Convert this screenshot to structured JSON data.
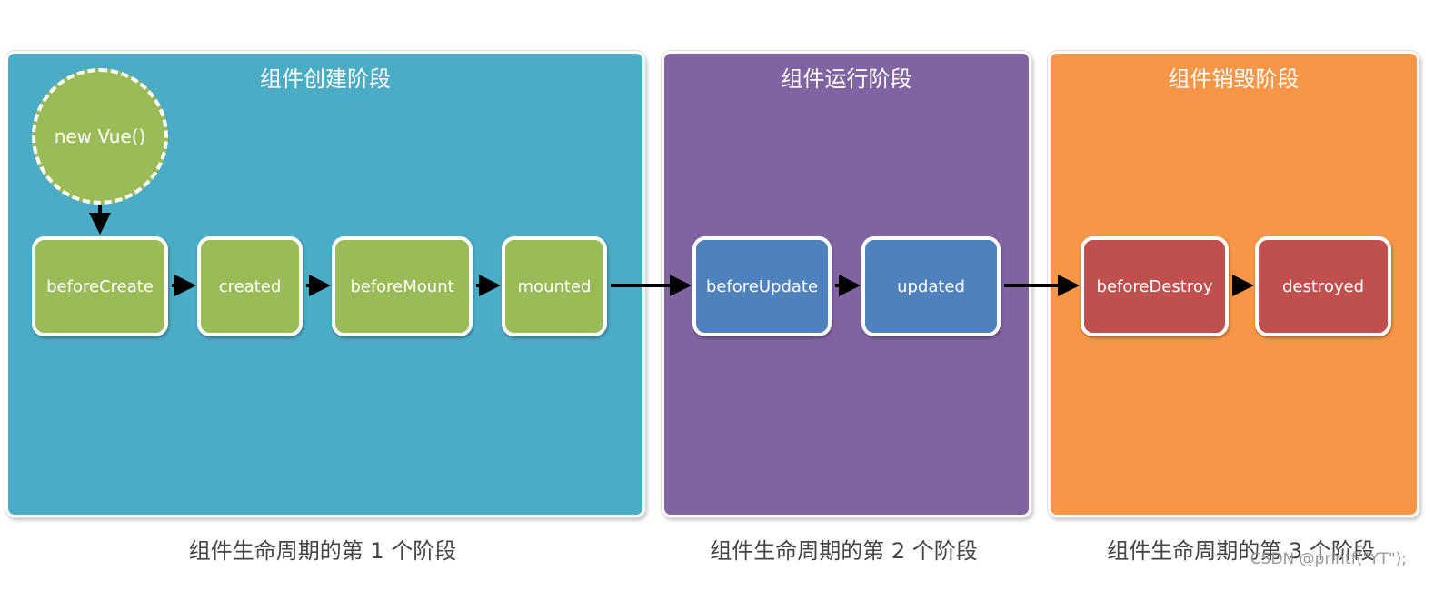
{
  "colors": {
    "create": "#4BACC6",
    "run": "#8064A2",
    "destroy": "#F79646",
    "hook_green": "#9BBB59",
    "hook_blue": "#4F81BD",
    "hook_red": "#C0504D"
  },
  "panels": [
    {
      "title": "组件创建阶段"
    },
    {
      "title": "组件运行阶段"
    },
    {
      "title": "组件销毁阶段"
    }
  ],
  "start": "new Vue()",
  "hooks": [
    "beforeCreate",
    "created",
    "beforeMount",
    "mounted",
    "beforeUpdate",
    "updated",
    "beforeDestroy",
    "destroyed"
  ],
  "captions": [
    "组件生命周期的第 1 个阶段",
    "组件生命周期的第 2 个阶段",
    "组件生命周期的第 3 个阶段"
  ],
  "watermark": "CSDN @printf(\"YT\");"
}
